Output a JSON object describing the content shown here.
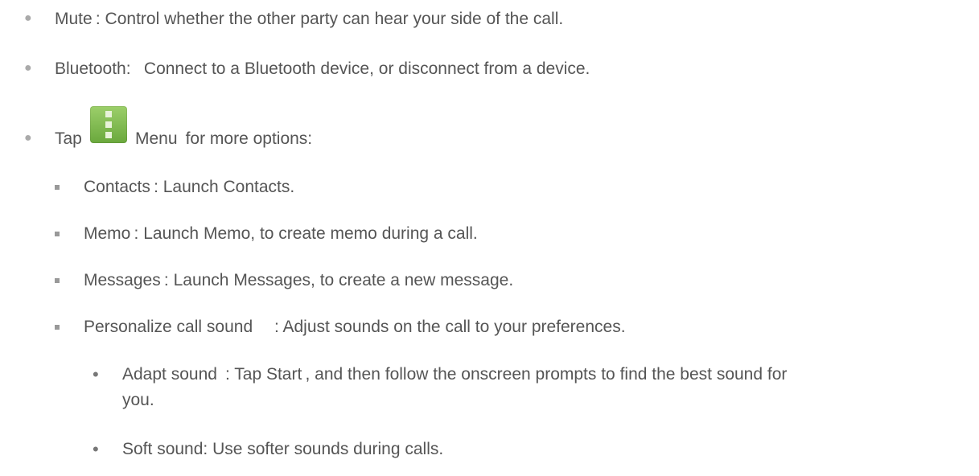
{
  "items": [
    {
      "text": "Mute : Control whether the other party can hear your side of the call."
    },
    {
      "text": "Bluetooth:  Connect to a Bluetooth device, or disconnect from a device."
    },
    {
      "prefix": "Tap",
      "icon": "menu-icon",
      "suffix": "Menu  for more options:"
    }
  ],
  "subitems": [
    {
      "text": "Contacts : Launch Contacts."
    },
    {
      "text": "Memo : Launch Memo, to create memo during a call."
    },
    {
      "text": "Messages : Launch Messages, to create a new message."
    },
    {
      "text": "Personalize call sound  : Adjust sounds on the call to your preferences."
    }
  ],
  "subsubitems": [
    {
      "line1": "Adapt sound  : Tap Start , and then follow the onscreen prompts to find the best sound for",
      "line2": "you."
    },
    {
      "text": "Soft sound: Use softer sounds during calls."
    }
  ],
  "colors": {
    "text": "#555555",
    "bullet": "#aaaaaa",
    "icon_green": "#7cb94a"
  }
}
